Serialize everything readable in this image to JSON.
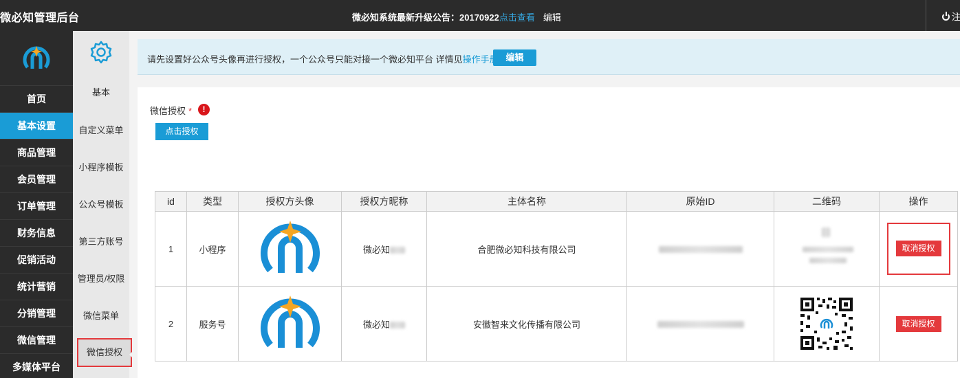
{
  "header": {
    "brand": "微必知管理后台",
    "notice_prefix": "微必知系统最新升级公告：20170922",
    "notice_link": "点击查看",
    "edit": "编辑",
    "logout": "注"
  },
  "sidebar": {
    "items": [
      {
        "label": "首页"
      },
      {
        "label": "基本设置"
      },
      {
        "label": "商品管理"
      },
      {
        "label": "会员管理"
      },
      {
        "label": "订单管理"
      },
      {
        "label": "财务信息"
      },
      {
        "label": "促销活动"
      },
      {
        "label": "统计营销"
      },
      {
        "label": "分销管理"
      },
      {
        "label": "微信管理"
      },
      {
        "label": "多媒体平台"
      }
    ],
    "active_index": 1
  },
  "subnav": {
    "items": [
      {
        "label": "基本"
      },
      {
        "label": "自定义菜单"
      },
      {
        "label": "小程序模板"
      },
      {
        "label": "公众号模板"
      },
      {
        "label": "第三方账号"
      },
      {
        "label": "管理员/权限"
      },
      {
        "label": "微信菜单"
      },
      {
        "label": "微信授权"
      }
    ]
  },
  "tip": {
    "text": "请先设置好公众号头像再进行授权，一个公众号只能对接一个微必知平台 详情见",
    "link": "操作手册",
    "button": "编辑"
  },
  "auth": {
    "label": "微信授权",
    "required_mark": "*",
    "warn": "!",
    "button": "点击授权"
  },
  "table": {
    "headers": [
      "id",
      "类型",
      "授权方头像",
      "授权方昵称",
      "主体名称",
      "原始ID",
      "二维码",
      "操作"
    ],
    "rows": [
      {
        "id": "1",
        "type": "小程序",
        "nickname": "微必知",
        "entity": "合肥微必知科技有限公司",
        "action": "取消授权"
      },
      {
        "id": "2",
        "type": "服务号",
        "nickname": "微必知",
        "entity": "安徽智来文化传播有限公司",
        "action": "取消授权"
      }
    ]
  },
  "colors": {
    "dark": "#2b2b2b",
    "accent": "#1a9cd6",
    "danger": "#e4393c"
  }
}
